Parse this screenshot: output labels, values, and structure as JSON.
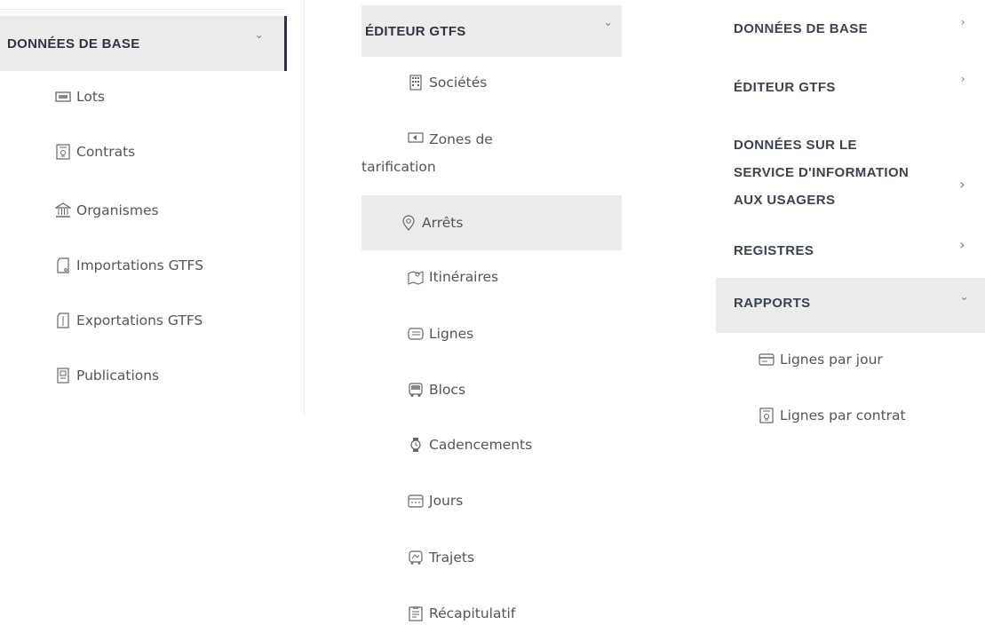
{
  "panel1": {
    "header": "DONNÉES DE BASE",
    "items": [
      {
        "label": "Lots",
        "icon": "lots-icon"
      },
      {
        "label": "Contrats",
        "icon": "contract-icon"
      },
      {
        "label": "Organismes",
        "icon": "organization-icon"
      },
      {
        "label": "Importations GTFS",
        "icon": "import-icon"
      },
      {
        "label": "Exportations GTFS",
        "icon": "export-icon"
      },
      {
        "label": "Publications",
        "icon": "publication-icon"
      }
    ]
  },
  "panel2": {
    "header": "ÉDITEUR GTFS",
    "items": [
      {
        "label": "Sociétés",
        "icon": "building-icon"
      },
      {
        "label": "Zones de tarification",
        "icon": "fare-zone-icon"
      },
      {
        "label": "Arrêts",
        "icon": "map-pin-icon"
      },
      {
        "label": "Itinéraires",
        "icon": "route-map-icon"
      },
      {
        "label": "Lignes",
        "icon": "lines-icon"
      },
      {
        "label": "Blocs",
        "icon": "bus-icon"
      },
      {
        "label": "Cadencements",
        "icon": "watch-icon"
      },
      {
        "label": "Jours",
        "icon": "calendar-icon"
      },
      {
        "label": "Trajets",
        "icon": "trip-icon"
      },
      {
        "label": "Récapitulatif",
        "icon": "summary-icon"
      }
    ]
  },
  "panel3": {
    "menus": [
      {
        "label": "DONNÉES DE BASE"
      },
      {
        "label": "ÉDITEUR GTFS"
      },
      {
        "label_lines": [
          "DONNÉES SUR LE",
          "SERVICE D'INFORMATION",
          "AUX USAGERS"
        ]
      },
      {
        "label": "REGISTRES"
      },
      {
        "label": "RAPPORTS"
      }
    ],
    "items": [
      {
        "label": "Lignes par jour",
        "icon": "report-card-icon"
      },
      {
        "label": "Lignes par contrat",
        "icon": "contract-icon"
      }
    ]
  },
  "colors": {
    "selected_bg": "#ececec",
    "active_bar": "#2e3440",
    "header_text": "#2e3440",
    "item_text": "#555555"
  }
}
